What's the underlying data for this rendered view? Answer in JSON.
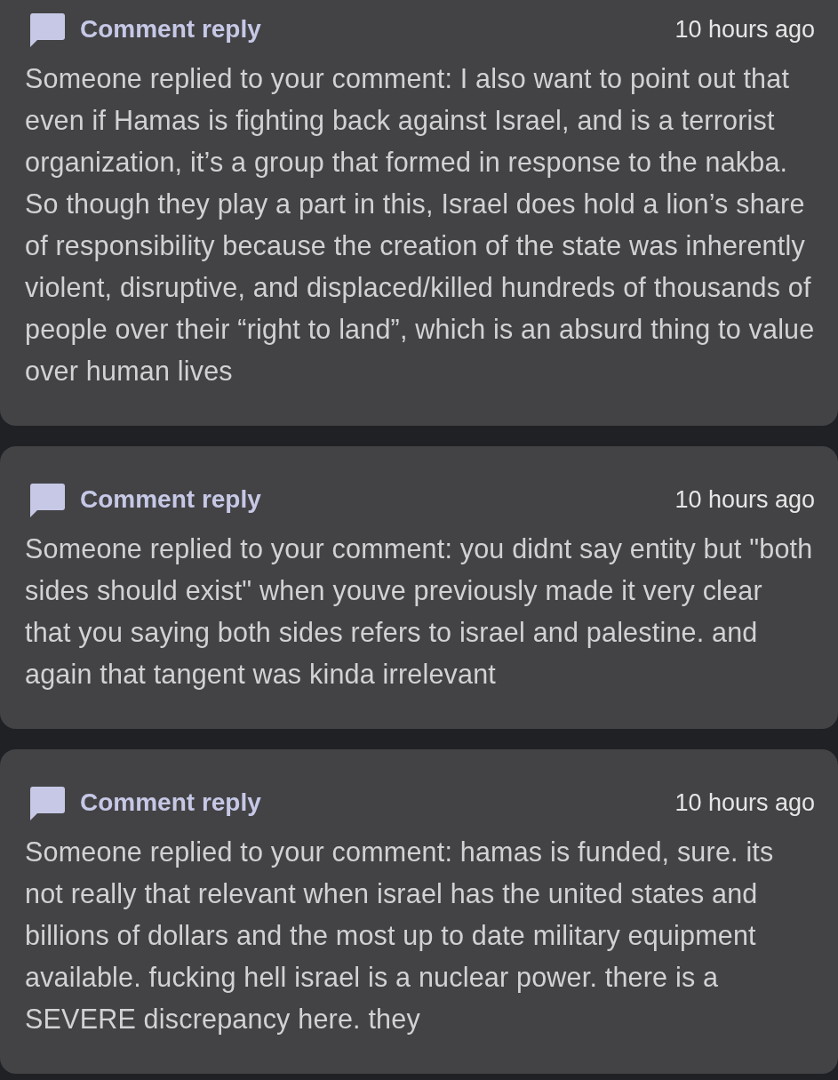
{
  "notifications": [
    {
      "title": "Comment reply",
      "time": "10 hours ago",
      "text": "Someone replied to your comment: I also want to point out that even if Hamas is fighting back against Israel, and is a terrorist organization, it’s a group that formed in response to the nakba. So though they play a part in this, Israel does hold a lion’s share of responsibility because the creation of the state was inherently violent, disruptive, and displaced/killed hundreds of thousands of people over their “right to land”, which is an absurd thing to value over human lives"
    },
    {
      "title": "Comment reply",
      "time": "10 hours ago",
      "text": "Someone replied to your comment: you didnt say entity but \"both sides should exist\" when youve previously made it very clear that you saying both sides refers to israel and palestine. and again that tangent was kinda irrelevant"
    },
    {
      "title": "Comment reply",
      "time": "10 hours ago",
      "text": "Someone replied to your comment: hamas is funded, sure. its not really that relevant when israel has the united states and billions of dollars and the most up to date military equipment available. fucking hell israel is a nuclear power. there is a SEVERE discrepancy here. they"
    }
  ]
}
